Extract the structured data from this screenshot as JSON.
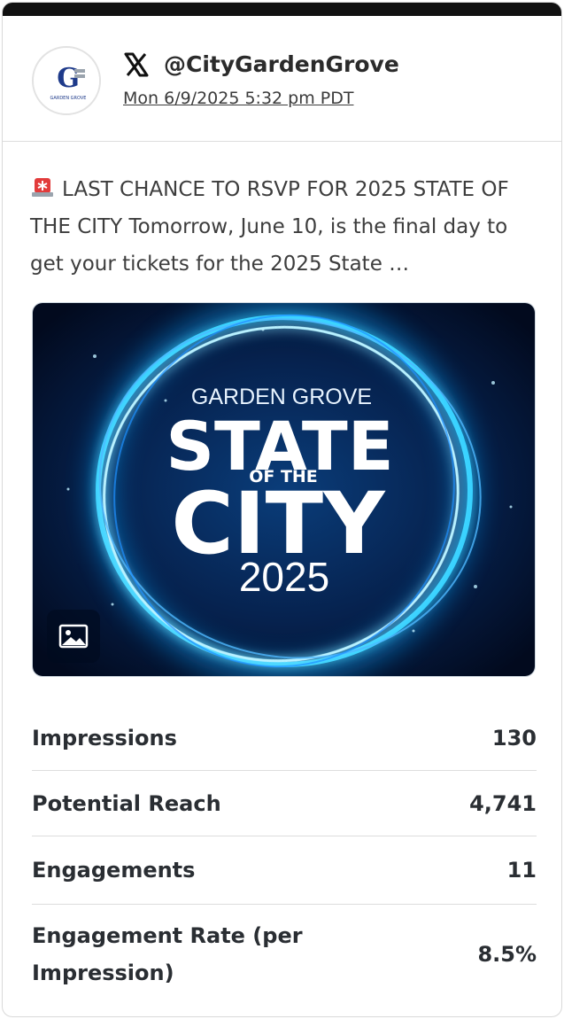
{
  "post": {
    "handle": "@CityGardenGrove",
    "timestamp": "Mon 6/9/2025 5:32 pm PDT",
    "text": "LAST CHANCE TO RSVP FOR 2025 STATE OF THE CITY Tomorrow, June 10, is the final day to get your tickets for the 2025 State …",
    "alert_icon": "rotating-light-icon",
    "network_icon": "x-logo-icon",
    "avatar_logo_text": "G",
    "avatar_subtext": "GARDEN GROVE"
  },
  "media": {
    "line1": "GARDEN GROVE",
    "line2": "STATE",
    "line3": "OF THE",
    "line4": "CITY",
    "line5": "2025",
    "badge_icon": "image-icon"
  },
  "stats": [
    {
      "label": "Impressions",
      "value": "130"
    },
    {
      "label": "Potential Reach",
      "value": "4,741"
    },
    {
      "label": "Engagements",
      "value": "11"
    },
    {
      "label": "Engagement Rate (per Impression)",
      "value": "8.5%"
    }
  ],
  "colors": {
    "topbar": "#111111",
    "text": "#3d3d3d",
    "media_glow": "#27c8ff",
    "alert_red": "#e23b3b"
  }
}
